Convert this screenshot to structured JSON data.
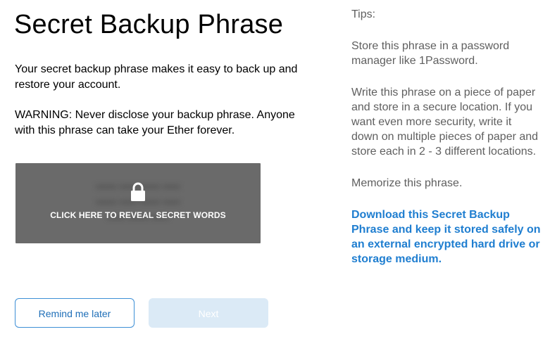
{
  "title": "Secret Backup Phrase",
  "description": "Your secret backup phrase makes it easy to back up and restore your account.",
  "warning": "WARNING: Never disclose your backup phrase. Anyone with this phrase can take your Ether forever.",
  "reveal": {
    "label": "CLICK HERE TO REVEAL SECRET WORDS",
    "icon": "lock-icon",
    "blurred_lines": [
      "•••••• ••••• •••••• •••••",
      "•••••• ••••• •••••• •••••",
      "••••• •••••• •••••"
    ]
  },
  "buttons": {
    "remind_later": "Remind me later",
    "next": "Next"
  },
  "tips": {
    "heading": "Tips:",
    "items": [
      "Store this phrase in a password manager like 1Password.",
      "Write this phrase on a piece of paper and store in a secure location. If you want even more security, write it down on multiple pieces of paper and store each in 2 - 3 different locations.",
      "Memorize this phrase."
    ],
    "download_link": "Download this Secret Backup Phrase and keep it stored safely on an external encrypted hard drive or storage medium."
  },
  "colors": {
    "accent": "#1f7ed0",
    "reveal_bg": "#6a6a6a",
    "next_disabled_bg": "#dbeaf6"
  }
}
